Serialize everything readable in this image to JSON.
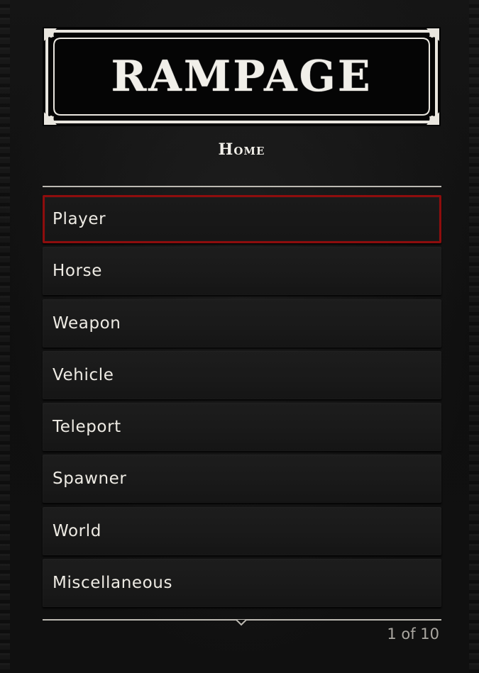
{
  "menu": {
    "title": "RAMPAGE",
    "subtitle": "Home",
    "items": [
      {
        "label": "Player",
        "selected": true
      },
      {
        "label": "Horse"
      },
      {
        "label": "Weapon"
      },
      {
        "label": "Vehicle"
      },
      {
        "label": "Teleport"
      },
      {
        "label": "Spawner"
      },
      {
        "label": "World"
      },
      {
        "label": "Miscellaneous"
      }
    ],
    "pager": "1 of 10"
  },
  "colors": {
    "selection_border": "#8e0d0d",
    "text": "#eeebe4",
    "background": "#111111"
  }
}
